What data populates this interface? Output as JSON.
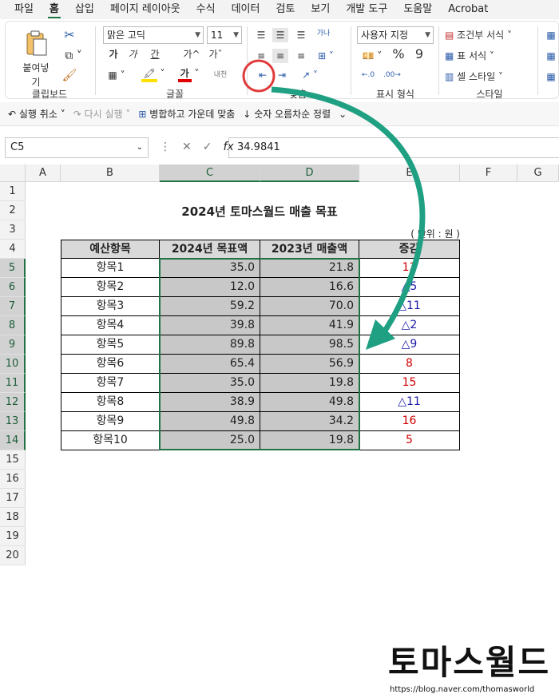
{
  "menu": {
    "items": [
      "파일",
      "홈",
      "삽입",
      "페이지 레이아웃",
      "수식",
      "데이터",
      "검토",
      "보기",
      "개발 도구",
      "도움말",
      "Acrobat"
    ]
  },
  "ribbon": {
    "paste_label": "붙여넣기",
    "font_name": "맑은 고딕",
    "font_size": "11",
    "number_format": "사용자 지정",
    "conditional_format": "조건부 서식",
    "table_format": "표 서식",
    "cell_style": "셀 스타일",
    "group_clipboard": "클립보드",
    "group_font": "글꼴",
    "group_align": "맞춤",
    "group_number": "표시 형식",
    "group_style": "스타일",
    "wrap_text_icon_text": "가나",
    "font_bold": "가",
    "font_italic": "가",
    "font_underline": "간",
    "font_grow": "가^",
    "font_shrink": "가ˇ",
    "phonetic": "내천"
  },
  "qat": {
    "undo": "실행 취소",
    "redo": "다시 실행",
    "merge_center": "병합하고 가운데 맞춤",
    "sort_number": "숫자 오름차순 정렬"
  },
  "formula_bar": {
    "name_box": "C5",
    "formula": "34.9841"
  },
  "columns": [
    "A",
    "B",
    "C",
    "D",
    "E",
    "F",
    "G"
  ],
  "rows": [
    "1",
    "2",
    "3",
    "4",
    "5",
    "6",
    "7",
    "8",
    "9",
    "10",
    "11",
    "12",
    "13",
    "14",
    "15",
    "16",
    "17",
    "18",
    "19",
    "20"
  ],
  "sheet": {
    "title": "2024년 토마스월드 매출 목표",
    "unit": "( 단위 : 원 )",
    "headers": [
      "예산항목",
      "2024년 목표액",
      "2023년 매출액",
      "증감"
    ],
    "data": [
      {
        "item": "항목1",
        "target": "35.0",
        "sales": "21.8",
        "diff": "13",
        "dir": "up"
      },
      {
        "item": "항목2",
        "target": "12.0",
        "sales": "16.6",
        "diff": "△5",
        "dir": "down"
      },
      {
        "item": "항목3",
        "target": "59.2",
        "sales": "70.0",
        "diff": "△11",
        "dir": "down"
      },
      {
        "item": "항목4",
        "target": "39.8",
        "sales": "41.9",
        "diff": "△2",
        "dir": "down"
      },
      {
        "item": "항목5",
        "target": "89.8",
        "sales": "98.5",
        "diff": "△9",
        "dir": "down"
      },
      {
        "item": "항목6",
        "target": "65.4",
        "sales": "56.9",
        "diff": "8",
        "dir": "up"
      },
      {
        "item": "항목7",
        "target": "35.0",
        "sales": "19.8",
        "diff": "15",
        "dir": "up"
      },
      {
        "item": "항목8",
        "target": "38.9",
        "sales": "49.8",
        "diff": "△11",
        "dir": "down"
      },
      {
        "item": "항목9",
        "target": "49.8",
        "sales": "34.2",
        "diff": "16",
        "dir": "up"
      },
      {
        "item": "항목10",
        "target": "25.0",
        "sales": "19.8",
        "diff": "5",
        "dir": "up"
      }
    ]
  },
  "watermark": {
    "logo": "토마스월드",
    "url": "https://blog.naver.com/thomasworld"
  },
  "colors": {
    "accent_green": "#217346",
    "annotation_teal": "#1fa082",
    "highlight_red": "#e03b3b"
  }
}
